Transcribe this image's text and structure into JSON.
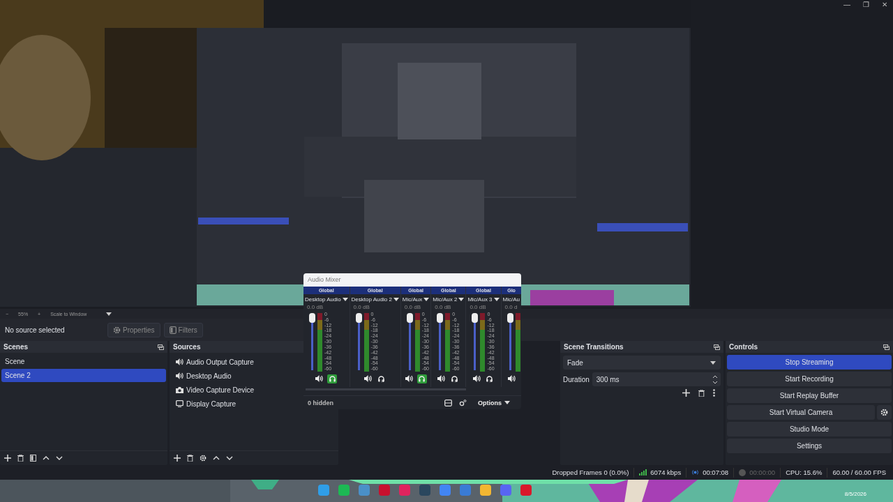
{
  "window": {
    "controls": [
      "—",
      "❐",
      "✕"
    ]
  },
  "preview_zoom": {
    "percent": "55%",
    "minus": "−",
    "plus": "+",
    "mode": "Scale to Window"
  },
  "source_toolbar": {
    "status": "No source selected",
    "buttons": [
      "Properties",
      "Filters"
    ]
  },
  "scenes": {
    "title": "Scenes",
    "items": [
      {
        "label": "Scene",
        "selected": false
      },
      {
        "label": "Scene 2",
        "selected": true
      }
    ]
  },
  "sources": {
    "title": "Sources",
    "items": [
      {
        "label": "Audio Output Capture",
        "kind": "audio"
      },
      {
        "label": "Desktop Audio",
        "kind": "audio"
      },
      {
        "label": "Video Capture Device",
        "kind": "camera"
      },
      {
        "label": "Display Capture",
        "kind": "display"
      }
    ]
  },
  "audio_mixer": {
    "title": "Audio Mixer",
    "channels": [
      {
        "header": "Global",
        "name": "Desktop Audio",
        "db": "0.0 dB",
        "level": 1,
        "monitor": true,
        "scale": [
          "0",
          "-6",
          "-12",
          "-18",
          "-24",
          "-30",
          "-36",
          "-42",
          "-48",
          "-54",
          "-60"
        ]
      },
      {
        "header": "Global",
        "name": "Desktop Audio 2",
        "db": "0.0 dB",
        "level": 1,
        "monitor": false,
        "scale": [
          "0",
          "-6",
          "-12",
          "-18",
          "-24",
          "-30",
          "-36",
          "-42",
          "-48",
          "-54",
          "-60"
        ]
      },
      {
        "header": "Global",
        "name": "Mic/Aux",
        "db": "0.0 dB",
        "level": 1,
        "monitor": true,
        "scale": [
          "0",
          "-6",
          "-12",
          "-18",
          "-24",
          "-30",
          "-36",
          "-42",
          "-48",
          "-54",
          "-60"
        ]
      },
      {
        "header": "Global",
        "name": "Mic/Aux 2",
        "db": "0.0 dB",
        "level": 1,
        "monitor": false,
        "scale": [
          "0",
          "-6",
          "-12",
          "-18",
          "-24",
          "-30",
          "-36",
          "-42",
          "-48",
          "-54",
          "-60"
        ]
      },
      {
        "header": "Global",
        "name": "Mic/Aux 3",
        "db": "0.0 dB",
        "level": 1,
        "monitor": false,
        "scale": [
          "0",
          "-6",
          "-12",
          "-18",
          "-24",
          "-30",
          "-36",
          "-42",
          "-48",
          "-54",
          "-60"
        ]
      },
      {
        "header": "Glo",
        "name": "Mic/Au",
        "db": "0.0 d",
        "level": 1
      }
    ],
    "hidden": "0 hidden",
    "options": "Options"
  },
  "scene_transitions": {
    "title": "Scene Transitions",
    "transition": "Fade",
    "duration_label": "Duration",
    "duration": "300 ms"
  },
  "controls": {
    "title": "Controls",
    "buttons": [
      {
        "label": "Stop Streaming",
        "active": true,
        "kind": "plain"
      },
      {
        "label": "Start Recording",
        "active": false,
        "kind": "plain"
      },
      {
        "label": "Start Replay Buffer",
        "active": false,
        "kind": "plain"
      },
      {
        "label": "Start Virtual Camera",
        "active": false,
        "kind": "with-settings"
      },
      {
        "label": "Studio Mode",
        "active": false,
        "kind": "plain"
      },
      {
        "label": "Settings",
        "active": false,
        "kind": "plain"
      }
    ]
  },
  "status_bar": {
    "dropped_frames": "Dropped Frames 0 (0.0%)",
    "bitrate": "6074 kbps",
    "stream_time": "00:07:08",
    "record_time": "00:00:00",
    "recording": false,
    "cpu": "CPU: 15.6%",
    "fps": "60.00 / 60.00 FPS"
  },
  "taskbar": {
    "date": "8/5/2026",
    "apps": [
      {
        "color": "#2f9ee8"
      },
      {
        "color": "#1db954"
      },
      {
        "color": "#4a90c8"
      },
      {
        "color": "#c8102e"
      },
      {
        "color": "#e0245e"
      },
      {
        "color": "#2a475e"
      },
      {
        "color": "#4285f4"
      },
      {
        "color": "#3a7bd5"
      },
      {
        "color": "#f2b632"
      },
      {
        "color": "#5865f2"
      },
      {
        "color": "#d9192b"
      }
    ]
  }
}
